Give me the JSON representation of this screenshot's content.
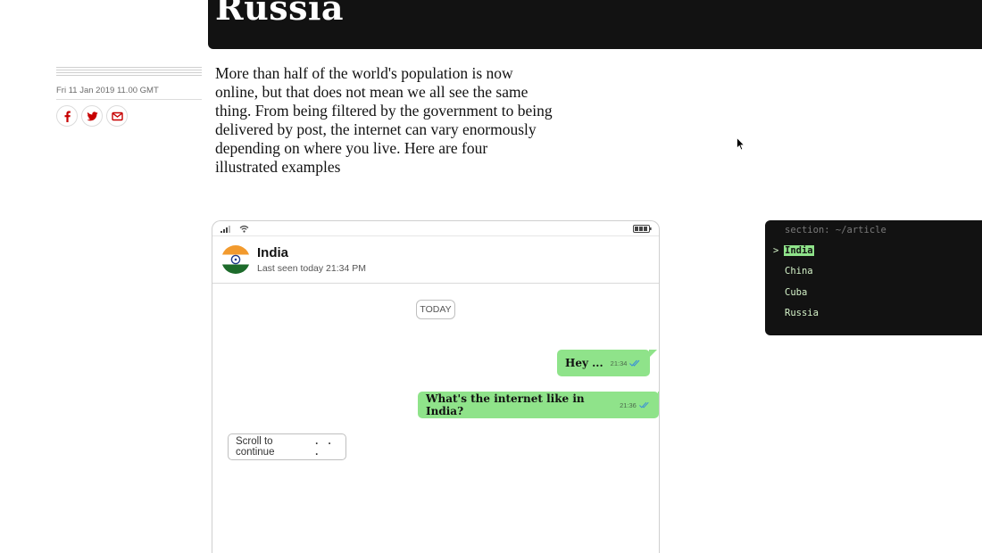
{
  "headline": {
    "text": "Russia"
  },
  "meta": {
    "date": "Fri 11 Jan 2019 11.00 GMT",
    "share": [
      {
        "name": "facebook-icon"
      },
      {
        "name": "twitter-icon"
      },
      {
        "name": "email-icon"
      }
    ]
  },
  "standfirst": "More than half of the world's population is now online, but that does not mean we all see the same thing. From being filtered by the government to being delivered by post, the internet can vary enormously depending on where you live. Here are four illustrated examples",
  "chat": {
    "contact_name": "India",
    "last_seen": "Last seen today 21:34 PM",
    "date_chip": "TODAY",
    "messages": [
      {
        "text": "Hey ...",
        "time": "21:34"
      },
      {
        "text": "What's the internet like in India?",
        "time": "21:36"
      }
    ],
    "scroll_prompt": "Scroll to continue",
    "scroll_dots": ". . ."
  },
  "terminal": {
    "path": "section: ~/article",
    "caret": ">",
    "items": [
      "India",
      "China",
      "Cuba",
      "Russia"
    ],
    "active": "India"
  },
  "colors": {
    "dark": "#121212",
    "bubble_green": "#8fe38a",
    "accent_red": "#c70000",
    "flag_saffron": "#f29a2e",
    "flag_green": "#1d6b2b",
    "chakra_blue": "#1f3a8a"
  }
}
